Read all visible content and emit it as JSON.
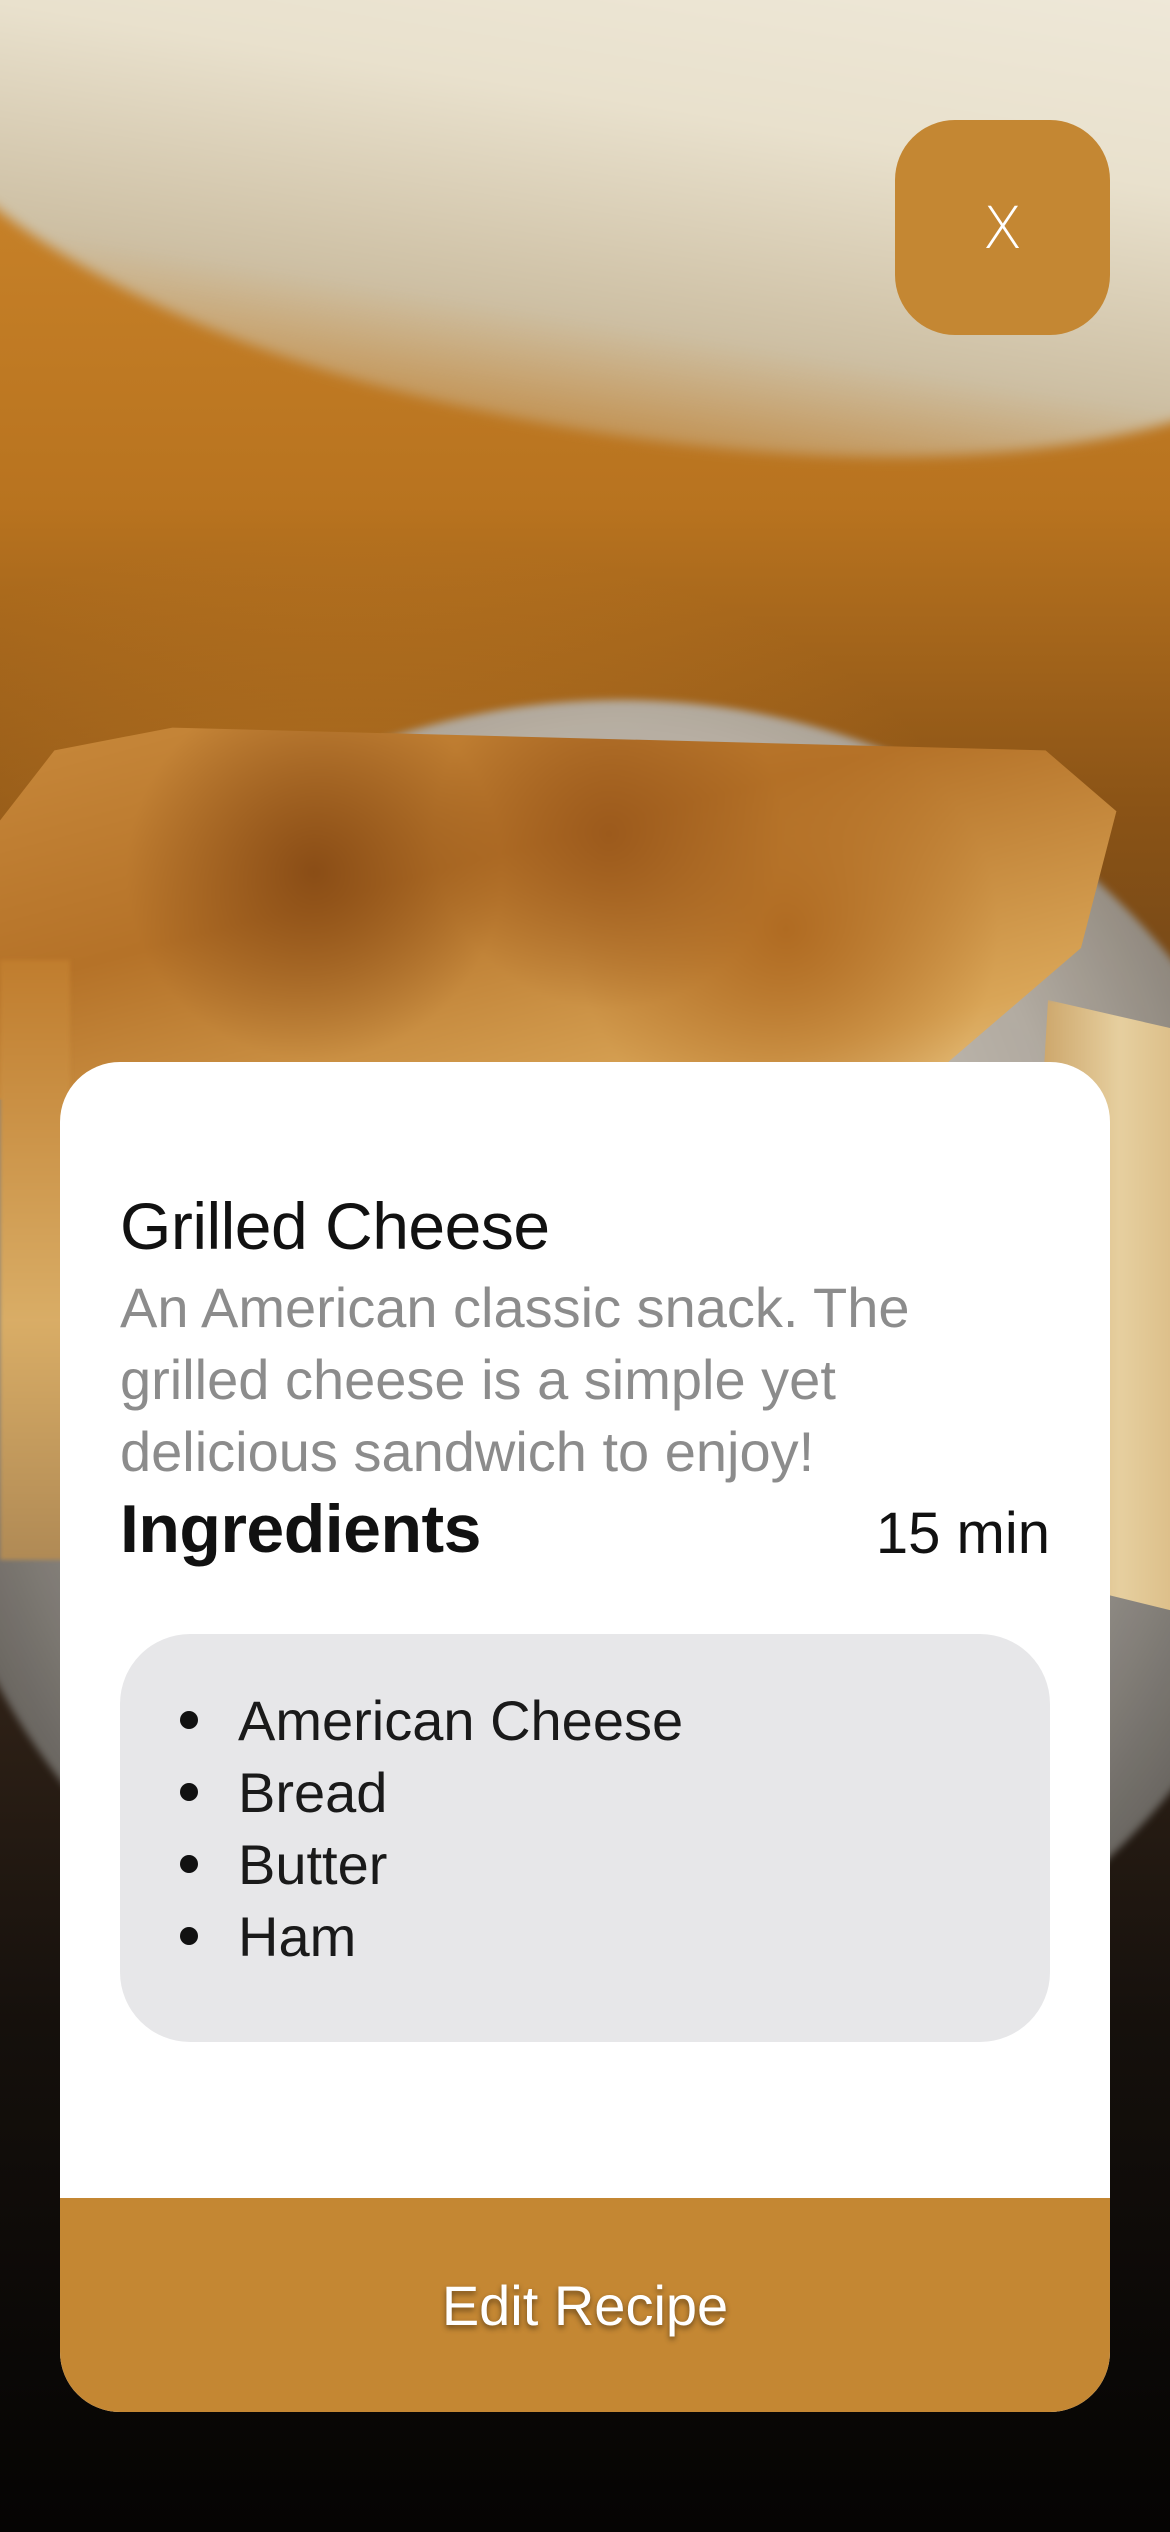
{
  "header": {
    "close_label": "X"
  },
  "recipe": {
    "title": "Grilled Cheese",
    "description": "An American classic snack. The grilled cheese is a simple yet delicious sandwich to enjoy!",
    "ingredients_heading": "Ingredients",
    "cook_time": "15 min",
    "ingredients": [
      "American Cheese",
      "Bread",
      "Butter",
      "Ham"
    ]
  },
  "actions": {
    "edit_label": "Edit Recipe"
  },
  "colors": {
    "accent": "#c48733",
    "card": "#ffffff",
    "ingredients_box": "#e7e7e9",
    "description_text": "#8c8c8c"
  }
}
